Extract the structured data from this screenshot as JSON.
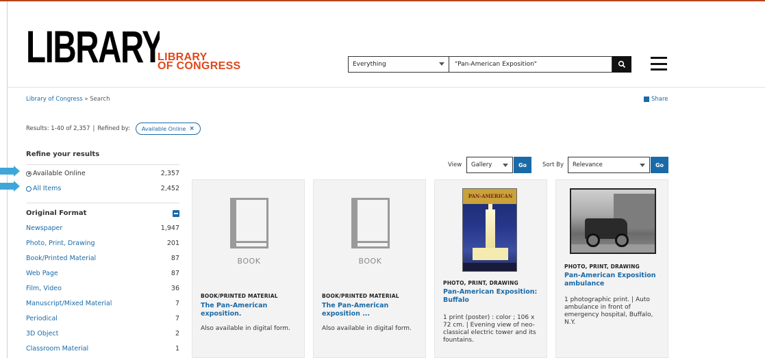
{
  "header": {
    "logo_main": "LIBRARY",
    "logo_sub_line1": "LIBRARY",
    "logo_sub_line2": "OF CONGRESS",
    "search_scope": "Everything",
    "search_query": "\"Pan-American Exposition\"",
    "search_icon": "search-icon",
    "menu_icon": "hamburger-menu-icon"
  },
  "breadcrumb": {
    "home": "Library of Congress",
    "separator": "»",
    "current": "Search"
  },
  "share_label": "Share",
  "results": {
    "summary": "Results: 1-40 of 2,357",
    "separator": "|",
    "refined_by_label": "Refined by:",
    "chip_label": "Available Online",
    "chip_close": "×"
  },
  "sidebar": {
    "refine_title": "Refine your results",
    "availability": [
      {
        "label": "Available Online",
        "count": "2,357",
        "selected": true
      },
      {
        "label": "All Items",
        "count": "2,452",
        "selected": false
      }
    ],
    "format_title": "Original Format",
    "formats": [
      {
        "label": "Newspaper",
        "count": "1,947"
      },
      {
        "label": "Photo, Print, Drawing",
        "count": "201"
      },
      {
        "label": "Book/Printed Material",
        "count": "87"
      },
      {
        "label": "Web Page",
        "count": "87"
      },
      {
        "label": "Film, Video",
        "count": "36"
      },
      {
        "label": "Manuscript/Mixed Material",
        "count": "7"
      },
      {
        "label": "Periodical",
        "count": "7"
      },
      {
        "label": "3D Object",
        "count": "2"
      },
      {
        "label": "Classroom Material",
        "count": "1"
      }
    ]
  },
  "view": {
    "label": "View",
    "value": "Gallery",
    "go": "Go"
  },
  "sort": {
    "label": "Sort By",
    "value": "Relevance",
    "go": "Go"
  },
  "cards": [
    {
      "placeholder": "BOOK",
      "format": "BOOK/PRINTED MATERIAL",
      "title": "The Pan-American exposition.",
      "desc": "Also available in digital form."
    },
    {
      "placeholder": "BOOK",
      "format": "BOOK/PRINTED MATERIAL",
      "title": "The Pan-American exposition ...",
      "desc": "Also available in digital form."
    },
    {
      "poster_text": "PAN-AMERICAN",
      "format": "PHOTO, PRINT, DRAWING",
      "title": "Pan-American Exposition: Buffalo",
      "desc": "1 print (poster) : color ; 106 x 72 cm. | Evening view of neo-classical electric tower and its fountains."
    },
    {
      "format": "PHOTO, PRINT, DRAWING",
      "title": "Pan-American Exposition ambulance",
      "desc": "1 photographic print. | Auto ambulance in front of emergency hospital, Buffalo, N.Y."
    }
  ],
  "colors": {
    "accent_blue": "#1a6aa8",
    "logo_orange": "#e0471a",
    "pointer_blue": "#3fa6d9"
  }
}
